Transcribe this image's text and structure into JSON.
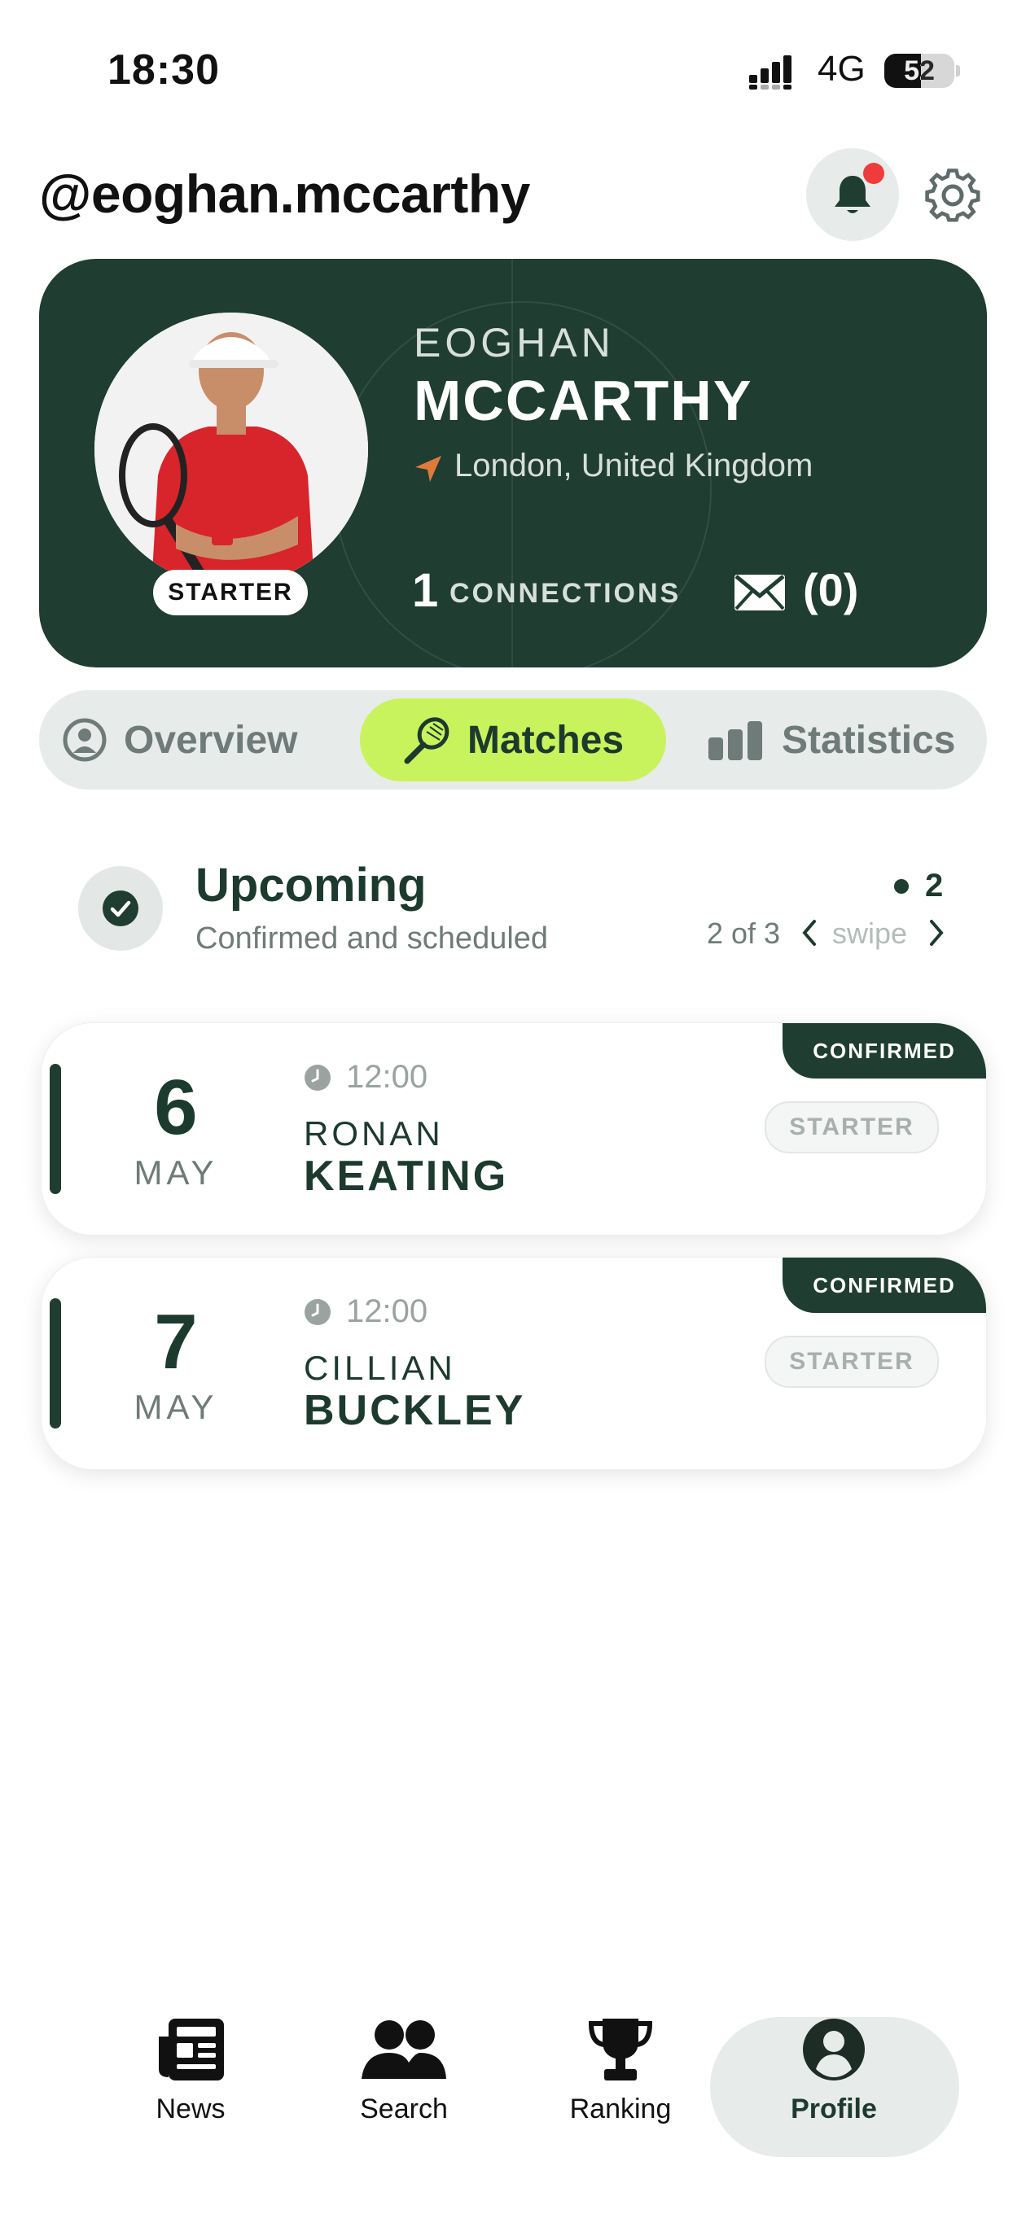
{
  "status_bar": {
    "time": "18:30",
    "network": "4G",
    "battery": "52",
    "battery_level": 0.52
  },
  "header": {
    "handle": "@eoghan.mccarthy",
    "notifications_unread": true
  },
  "profile": {
    "first_name": "EOGHAN",
    "last_name": "MCCARTHY",
    "location": "London, United Kingdom",
    "badge": "STARTER",
    "connections_count": "1",
    "connections_label": "CONNECTIONS",
    "messages": "(0)"
  },
  "tabs": [
    {
      "label": "Overview",
      "icon": "user-circle-icon",
      "active": false
    },
    {
      "label": "Matches",
      "icon": "tennis-racket-icon",
      "active": true
    },
    {
      "label": "Statistics",
      "icon": "bar-chart-icon",
      "active": false
    }
  ],
  "section": {
    "title": "Upcoming",
    "subtitle": "Confirmed and scheduled",
    "count": "2",
    "pager": "2 of 3",
    "swipe_hint": "swipe"
  },
  "matches": [
    {
      "day": "6",
      "month": "MAY",
      "time": "12:00",
      "opponent_first": "RONAN",
      "opponent_last": "KEATING",
      "status": "CONFIRMED",
      "role": "STARTER"
    },
    {
      "day": "7",
      "month": "MAY",
      "time": "12:00",
      "opponent_first": "CILLIAN",
      "opponent_last": "BUCKLEY",
      "status": "CONFIRMED",
      "role": "STARTER"
    }
  ],
  "nav": [
    {
      "label": "News",
      "icon": "newspaper-icon"
    },
    {
      "label": "Search",
      "icon": "users-icon"
    },
    {
      "label": "Ranking",
      "icon": "trophy-icon"
    },
    {
      "label": "Profile",
      "icon": "profile-icon",
      "active": true
    }
  ],
  "colors": {
    "brand_dark": "#1f3d31",
    "accent": "#c9f35d",
    "alert": "#ee3b3b"
  }
}
